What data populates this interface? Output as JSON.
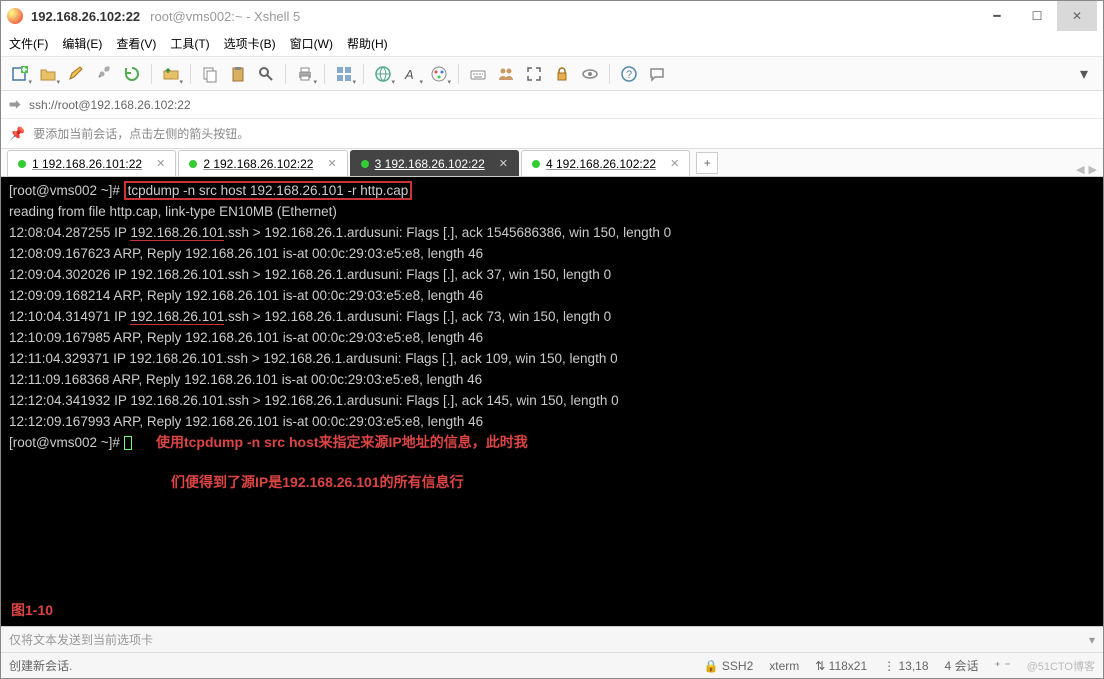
{
  "window": {
    "ip": "192.168.26.102:22",
    "subtitle": "root@vms002:~ - Xshell 5"
  },
  "menu": {
    "file": "文件(F)",
    "edit": "编辑(E)",
    "view": "查看(V)",
    "tools": "工具(T)",
    "tab": "选项卡(B)",
    "window": "窗口(W)",
    "help": "帮助(H)"
  },
  "toolbar_icons": {
    "new": "new-plus-icon",
    "open": "folder-icon",
    "pencil": "pencil-icon",
    "link": "link-icon",
    "reload": "reload-icon",
    "transfer": "transfer-icon",
    "copy": "copy-icon",
    "paste": "paste-icon",
    "search": "search-icon",
    "printer": "printer-icon",
    "tile": "tile-icon",
    "globe": "globe-icon",
    "font": "font-icon",
    "palette": "palette-icon",
    "keyboard": "keyboard-icon",
    "users": "users-icon",
    "fullscreen": "fullscreen-icon",
    "lock": "lock-icon",
    "eye": "eye-icon",
    "help": "help-icon",
    "chat": "chat-icon"
  },
  "address": {
    "scheme": "ssh://root@192.168.26.102:22"
  },
  "hint": "要添加当前会话，点击左侧的箭头按钮。",
  "tabs": [
    {
      "label": "1 192.168.26.101:22",
      "active": false
    },
    {
      "label": "2 192.168.26.102:22",
      "active": false
    },
    {
      "label": "3 192.168.26.102:22",
      "active": true
    },
    {
      "label": "4 192.168.26.102:22",
      "active": false
    }
  ],
  "add_tab": "+",
  "terminal": {
    "prompt1": "[root@vms002 ~]# ",
    "command": "tcpdump -n src host 192.168.26.101 -r http.cap",
    "lines": [
      "reading from file http.cap, link-type EN10MB (Ethernet)",
      "12:08:04.287255 IP 192.168.26.101.ssh > 192.168.26.1.ardusuni: Flags [.], ack 1545686386, win 150, length 0",
      "12:08:09.167623 ARP, Reply 192.168.26.101 is-at 00:0c:29:03:e5:e8, length 46",
      "12:09:04.302026 IP 192.168.26.101.ssh > 192.168.26.1.ardusuni: Flags [.], ack 37, win 150, length 0",
      "12:09:09.168214 ARP, Reply 192.168.26.101 is-at 00:0c:29:03:e5:e8, length 46",
      "12:10:04.314971 IP 192.168.26.101.ssh > 192.168.26.1.ardusuni: Flags [.], ack 73, win 150, length 0",
      "12:10:09.167985 ARP, Reply 192.168.26.101 is-at 00:0c:29:03:e5:e8, length 46",
      "12:11:04.329371 IP 192.168.26.101.ssh > 192.168.26.1.ardusuni: Flags [.], ack 109, win 150, length 0",
      "12:11:09.168368 ARP, Reply 192.168.26.101 is-at 00:0c:29:03:e5:e8, length 46",
      "12:12:04.341932 IP 192.168.26.101.ssh > 192.168.26.1.ardusuni: Flags [.], ack 145, win 150, length 0",
      "12:12:09.167993 ARP, Reply 192.168.26.101 is-at 00:0c:29:03:e5:e8, length 46"
    ],
    "underlined_ip": "192.168.26.101",
    "prompt2": "[root@vms002 ~]# ",
    "note1": "使用tcpdump -n src host来指定来源IP地址的信息，此时我",
    "note2": "们便得到了源IP是192.168.26.101的所有信息行",
    "figure": "图1-10"
  },
  "sendbar": {
    "text": "仅将文本发送到当前选项卡"
  },
  "status": {
    "left": "创建新会话.",
    "ssh": "SSH2",
    "term": "xterm",
    "size": "118x21",
    "pos": "13,18",
    "sessions": "4 会话",
    "extra": "↑ ↓",
    "watermark": "@51CTO博客"
  }
}
